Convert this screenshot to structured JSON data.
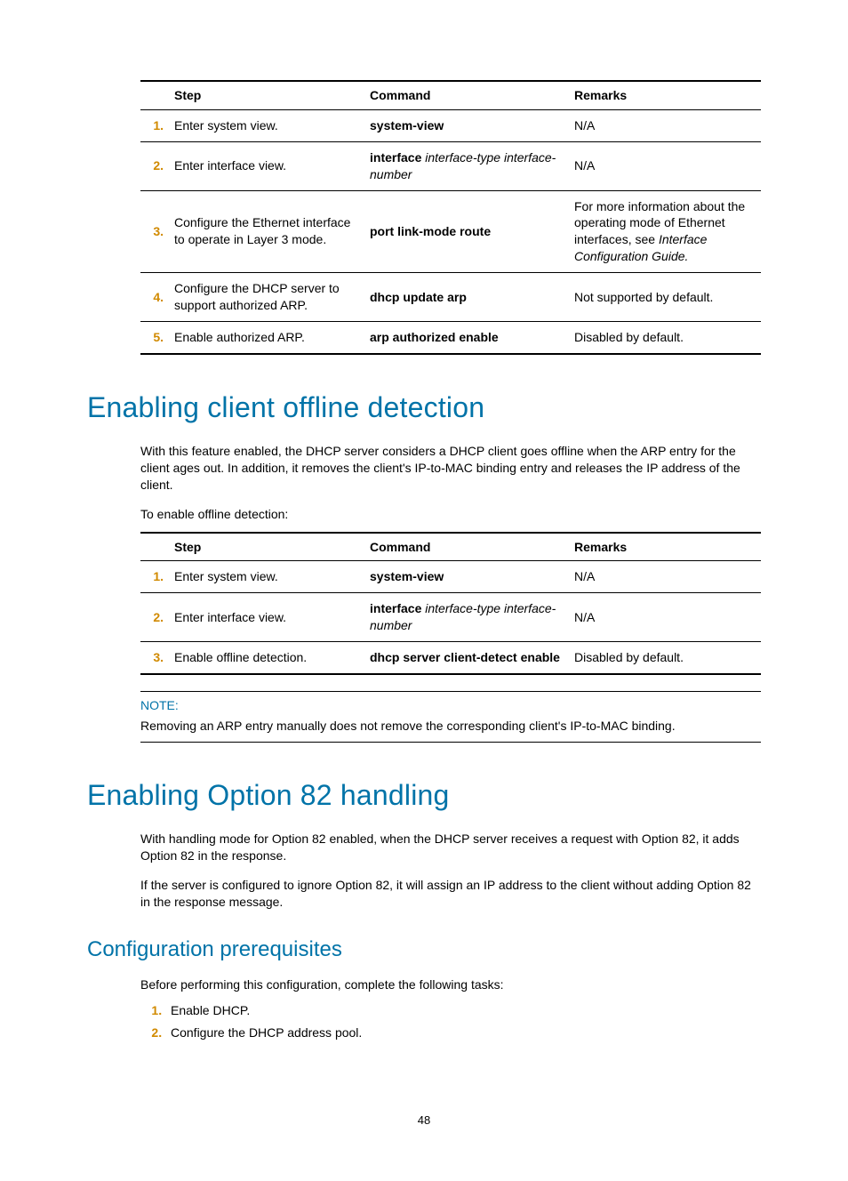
{
  "table1": {
    "headers": {
      "step": "Step",
      "command": "Command",
      "remarks": "Remarks"
    },
    "rows": [
      {
        "no": "1.",
        "step": "Enter system view.",
        "cmd_bold": "system-view",
        "cmd_ital": "",
        "remarks_plain": "N/A"
      },
      {
        "no": "2.",
        "step": "Enter interface view.",
        "cmd_bold": "interface",
        "cmd_ital": " interface-type interface-number",
        "remarks_plain": "N/A"
      },
      {
        "no": "3.",
        "step": "Configure the Ethernet interface to operate in Layer 3 mode.",
        "cmd_bold": "port link-mode route",
        "cmd_ital": "",
        "remarks_pre": "For more information about the operating mode of Ethernet interfaces, see ",
        "remarks_ital": "Interface Configuration Guide."
      },
      {
        "no": "4.",
        "step": "Configure the DHCP server to support authorized ARP.",
        "cmd_bold": "dhcp update arp",
        "cmd_ital": "",
        "remarks_plain": "Not supported by default."
      },
      {
        "no": "5.",
        "step": "Enable authorized ARP.",
        "cmd_bold": "arp authorized enable",
        "cmd_ital": "",
        "remarks_plain": "Disabled by default."
      }
    ]
  },
  "h1a": "Enabling client offline detection",
  "p1": "With this feature enabled, the DHCP server considers a DHCP client goes offline when the ARP entry for the client ages out. In addition, it removes the client's IP-to-MAC binding entry and releases the IP address of the client.",
  "p2": "To enable offline detection:",
  "table2": {
    "headers": {
      "step": "Step",
      "command": "Command",
      "remarks": "Remarks"
    },
    "rows": [
      {
        "no": "1.",
        "step": "Enter system view.",
        "cmd_bold": "system-view",
        "cmd_ital": "",
        "remarks_plain": "N/A"
      },
      {
        "no": "2.",
        "step": "Enter interface view.",
        "cmd_bold": "interface",
        "cmd_ital": " interface-type interface-number",
        "remarks_plain": "N/A"
      },
      {
        "no": "3.",
        "step": "Enable offline detection.",
        "cmd_bold": "dhcp server client-detect enable",
        "cmd_ital": "",
        "remarks_plain": "Disabled by default."
      }
    ]
  },
  "note_label": "NOTE:",
  "note_text": "Removing an ARP entry manually does not remove the corresponding client's IP-to-MAC binding.",
  "h1b": "Enabling Option 82 handling",
  "p3": "With handling mode for Option 82 enabled, when the DHCP server receives a request with Option 82, it adds Option 82 in the response.",
  "p4": "If the server is configured to ignore Option 82, it will assign an IP address to the client without adding Option 82 in the response message.",
  "h2a": "Configuration prerequisites",
  "p5": "Before performing this configuration, complete the following tasks:",
  "list": [
    "Enable DHCP.",
    "Configure the DHCP address pool."
  ],
  "pageno": "48"
}
